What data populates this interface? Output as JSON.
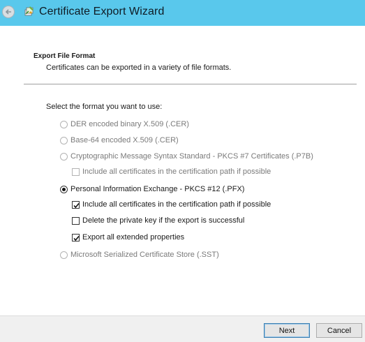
{
  "window": {
    "title": "Certificate Export Wizard"
  },
  "header": {
    "title": "Export File Format",
    "description": "Certificates can be exported in a variety of file formats."
  },
  "main": {
    "prompt": "Select the format you want to use:",
    "options": {
      "der": {
        "label": "DER encoded binary X.509 (.CER)",
        "selected": false,
        "enabled": false
      },
      "base64": {
        "label": "Base-64 encoded X.509 (.CER)",
        "selected": false,
        "enabled": false
      },
      "pkcs7": {
        "label": "Cryptographic Message Syntax Standard - PKCS #7 Certificates (.P7B)",
        "selected": false,
        "enabled": false
      },
      "pkcs7_include": {
        "label": "Include all certificates in the certification path if possible",
        "checked": false,
        "enabled": false
      },
      "pfx": {
        "label": "Personal Information Exchange - PKCS #12 (.PFX)",
        "selected": true,
        "enabled": true
      },
      "pfx_include": {
        "label": "Include all certificates in the certification path if possible",
        "checked": true,
        "enabled": true
      },
      "pfx_delete_key": {
        "label": "Delete the private key if the export is successful",
        "checked": false,
        "enabled": true
      },
      "pfx_export_ext": {
        "label": "Export all extended properties",
        "checked": true,
        "enabled": true
      },
      "sst": {
        "label": "Microsoft Serialized Certificate Store (.SST)",
        "selected": false,
        "enabled": false
      }
    }
  },
  "footer": {
    "next_label": "Next",
    "cancel_label": "Cancel"
  },
  "colors": {
    "titlebar": "#59c8ec",
    "disabled_text": "#7a7a7a"
  }
}
